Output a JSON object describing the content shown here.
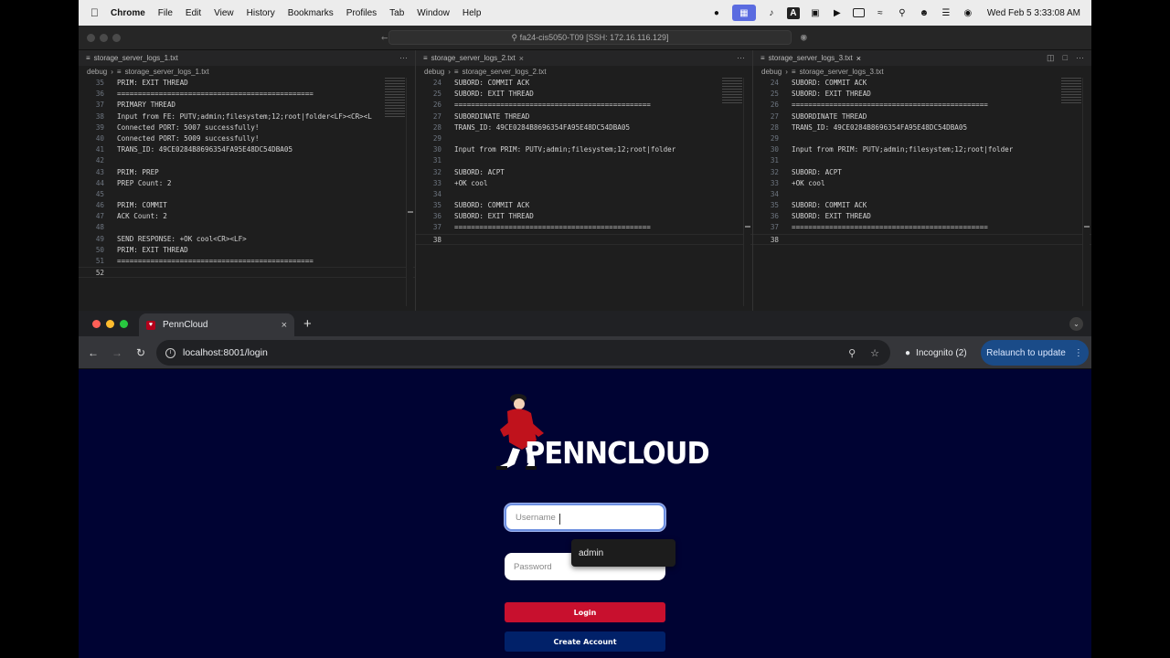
{
  "menubar": {
    "app_name": "Chrome",
    "items": [
      "File",
      "Edit",
      "View",
      "History",
      "Bookmarks",
      "Profiles",
      "Tab",
      "Window",
      "Help"
    ],
    "clock": "Wed Feb 5  3:33:08 AM"
  },
  "vscode": {
    "remote_title": "fa24-cis5050-T09 [SSH: 172.16.116.129]",
    "breadcrumb_folder": "debug",
    "panes": [
      {
        "tab": "storage_server_logs_1.txt",
        "lines": [
          {
            "n": "35",
            "t": "PRIM: EXIT THREAD"
          },
          {
            "n": "36",
            "t": "==============================================="
          },
          {
            "n": "37",
            "t": "PRIMARY THREAD"
          },
          {
            "n": "38",
            "t": "Input from FE: PUTV;admin;filesystem;12;root|folder<LF><CR><L"
          },
          {
            "n": "39",
            "t": "Connected PORT: 5007 successfully!"
          },
          {
            "n": "40",
            "t": "Connected PORT: 5009 successfully!"
          },
          {
            "n": "41",
            "t": "TRANS_ID: 49CE0284B8696354FA95E48DC54DBA05"
          },
          {
            "n": "42",
            "t": ""
          },
          {
            "n": "43",
            "t": "PRIM: PREP"
          },
          {
            "n": "44",
            "t": "PREP Count: 2"
          },
          {
            "n": "45",
            "t": ""
          },
          {
            "n": "46",
            "t": "PRIM: COMMIT"
          },
          {
            "n": "47",
            "t": "ACK Count: 2"
          },
          {
            "n": "48",
            "t": ""
          },
          {
            "n": "49",
            "t": "SEND RESPONSE: +OK cool<CR><LF>"
          },
          {
            "n": "50",
            "t": "PRIM: EXIT THREAD"
          },
          {
            "n": "51",
            "t": "==============================================="
          },
          {
            "n": "52",
            "t": ""
          }
        ]
      },
      {
        "tab": "storage_server_logs_2.txt",
        "lines": [
          {
            "n": "24",
            "t": "SUBORD: COMMIT ACK"
          },
          {
            "n": "25",
            "t": "SUBORD: EXIT THREAD"
          },
          {
            "n": "26",
            "t": "==============================================="
          },
          {
            "n": "27",
            "t": "SUBORDINATE THREAD"
          },
          {
            "n": "28",
            "t": "TRANS_ID: 49CE0284B8696354FA95E48DC54DBA05"
          },
          {
            "n": "29",
            "t": ""
          },
          {
            "n": "30",
            "t": "Input from PRIM: PUTV;admin;filesystem;12;root|folder"
          },
          {
            "n": "31",
            "t": ""
          },
          {
            "n": "32",
            "t": "SUBORD: ACPT"
          },
          {
            "n": "33",
            "t": "+OK cool"
          },
          {
            "n": "34",
            "t": ""
          },
          {
            "n": "35",
            "t": "SUBORD: COMMIT ACK"
          },
          {
            "n": "36",
            "t": "SUBORD: EXIT THREAD"
          },
          {
            "n": "37",
            "t": "==============================================="
          },
          {
            "n": "38",
            "t": ""
          }
        ]
      },
      {
        "tab": "storage_server_logs_3.txt",
        "lines": [
          {
            "n": "24",
            "t": "SUBORD: COMMIT ACK"
          },
          {
            "n": "25",
            "t": "SUBORD: EXIT THREAD"
          },
          {
            "n": "26",
            "t": "==============================================="
          },
          {
            "n": "27",
            "t": "SUBORDINATE THREAD"
          },
          {
            "n": "28",
            "t": "TRANS_ID: 49CE0284B8696354FA95E48DC54DBA05"
          },
          {
            "n": "29",
            "t": ""
          },
          {
            "n": "30",
            "t": "Input from PRIM: PUTV;admin;filesystem;12;root|folder"
          },
          {
            "n": "31",
            "t": ""
          },
          {
            "n": "32",
            "t": "SUBORD: ACPT"
          },
          {
            "n": "33",
            "t": "+OK cool"
          },
          {
            "n": "34",
            "t": ""
          },
          {
            "n": "35",
            "t": "SUBORD: COMMIT ACK"
          },
          {
            "n": "36",
            "t": "SUBORD: EXIT THREAD"
          },
          {
            "n": "37",
            "t": "==============================================="
          },
          {
            "n": "38",
            "t": ""
          }
        ]
      }
    ]
  },
  "browser": {
    "tab_title": "PennCloud",
    "url": "localhost:8001/login",
    "incognito_label": "Incognito (2)",
    "relaunch_label": "Relaunch to update"
  },
  "login": {
    "brand": "PENNCLOUD",
    "username_placeholder": "Username",
    "password_placeholder": "Password",
    "autofill_suggestion": "admin",
    "login_button": "Login",
    "create_account_button": "Create Account"
  },
  "colors": {
    "page_bg": "#000333",
    "login_red": "#c8102e",
    "create_blue": "#012169",
    "relaunch_bg": "#1a4b88"
  }
}
